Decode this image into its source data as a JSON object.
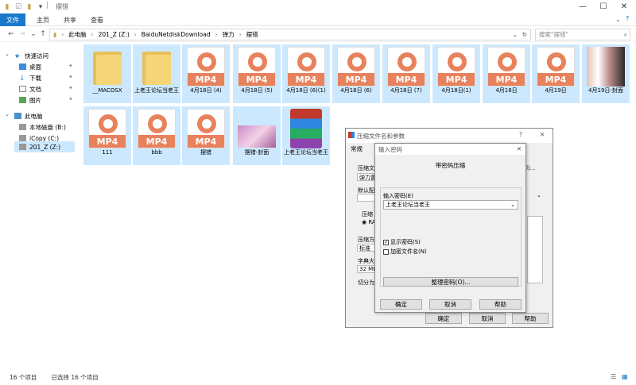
{
  "window": {
    "title": "摆错"
  },
  "ribbon": {
    "tabs": [
      "文件",
      "主页",
      "共享",
      "查看"
    ]
  },
  "address": {
    "path": [
      "此电脑",
      "201_Z (Z:)",
      "BaiduNetdiskDownload",
      "弹力",
      "摆错"
    ],
    "search_placeholder": "搜索\"摆错\""
  },
  "sidebar": {
    "items": [
      {
        "label": "快速访问",
        "icon": "star-icon"
      },
      {
        "label": "桌面",
        "icon": "desktop-icon"
      },
      {
        "label": "下载",
        "icon": "download-icon"
      },
      {
        "label": "文档",
        "icon": "document-icon"
      },
      {
        "label": "图片",
        "icon": "picture-icon"
      },
      {
        "label": "此电脑",
        "icon": "computer-icon"
      },
      {
        "label": "本地磁盘 (B:)",
        "icon": "drive-icon"
      },
      {
        "label": "iCopy (C:)",
        "icon": "drive-icon"
      },
      {
        "label": "201_Z (Z:)",
        "icon": "drive-icon"
      }
    ]
  },
  "files": [
    {
      "name": "__MACOSX",
      "type": "folder"
    },
    {
      "name": "上老王论坛当老王",
      "type": "folder"
    },
    {
      "name": "4月18日 (4)",
      "type": "mp4"
    },
    {
      "name": "4月18日 (5)",
      "type": "mp4"
    },
    {
      "name": "4月18日 (6)(1)",
      "type": "mp4"
    },
    {
      "name": "4月18日 (6)",
      "type": "mp4"
    },
    {
      "name": "4月18日 (7)",
      "type": "mp4"
    },
    {
      "name": "4月18日(1)",
      "type": "mp4"
    },
    {
      "name": "4月18日",
      "type": "mp4"
    },
    {
      "name": "4月19日",
      "type": "mp4"
    },
    {
      "name": "4月19日-封面",
      "type": "photo2"
    },
    {
      "name": "111",
      "type": "mp4"
    },
    {
      "name": "bbb",
      "type": "mp4"
    },
    {
      "name": "摆错",
      "type": "mp4"
    },
    {
      "name": "摆错-封面",
      "type": "photo"
    },
    {
      "name": "上老王论坛当老王",
      "type": "rar"
    }
  ],
  "mp4_badge": "MP4",
  "status": {
    "count": "16 个项目",
    "selected": "已选择 16 个项目"
  },
  "archive_dialog": {
    "title": "压缩文件名和参数",
    "help": "?",
    "tab": "常规",
    "frag_compress_file": "压缩文",
    "frag_tanli": "弹力置",
    "frag_default": "默认配",
    "frag_compress_format": "压缩",
    "frag_ra": "RA",
    "frag_method": "压缩方",
    "frag_standard": "标准",
    "frag_dict": "字典大",
    "frag_32mb": "32 MB",
    "frag_split": "切分为",
    "frag_browse": "即)...",
    "ok": "确定",
    "cancel": "取消",
    "helpbtn": "帮助"
  },
  "password_dialog": {
    "title": "输入密码",
    "header": "带密码压缩",
    "label": "输入密码(E)",
    "value": "上老王论坛当老王",
    "show_password": "显示密码(S)",
    "encrypt_names": "加密文件名(N)",
    "organize": "整理密码(O)...",
    "ok": "确定",
    "cancel": "取消",
    "help": "帮助"
  },
  "colors": {
    "mp4_accent": "#e8825c",
    "selection": "#cce8ff",
    "file_tab": "#1979ca"
  }
}
